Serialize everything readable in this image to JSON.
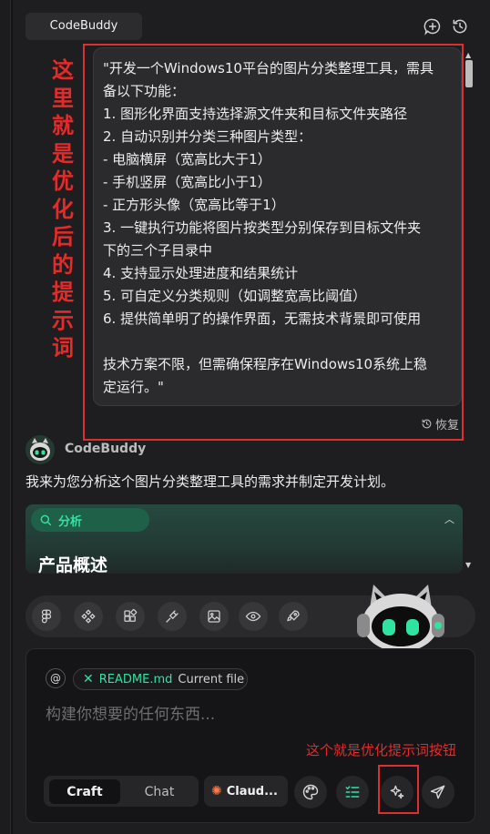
{
  "app": {
    "title": "CodeBuddy"
  },
  "header": {
    "new_chat_icon": "add-chat-icon",
    "history_icon": "history-icon"
  },
  "annotation": {
    "vertical_text": [
      "这",
      "里",
      "就",
      "是",
      "优",
      "化",
      "后",
      "的",
      "提",
      "示",
      "词"
    ],
    "button_note": "这个就是优化提示词按钮",
    "color": "#e52a2a"
  },
  "prompt": {
    "lines": [
      "\"开发一个Windows10平台的图片分类整理工具，需具",
      "备以下功能：",
      "1. 图形化界面支持选择源文件夹和目标文件夹路径",
      "2. 自动识别并分类三种图片类型：",
      "- 电脑横屏（宽高比大于1）",
      "- 手机竖屏（宽高比小于1）",
      "- 正方形头像（宽高比等于1）",
      "3. 一键执行功能将图片按类型分别保存到目标文件夹",
      "下的三个子目录中",
      "4. 支持显示处理进度和结果统计",
      "5. 可自定义分类规则（如调整宽高比阈值）",
      "6. 提供简单明了的操作界面，无需技术背景即可使用",
      "",
      "技术方案不限，但需确保程序在Windows10系统上稳",
      "定运行。\""
    ],
    "restore_label": "恢复"
  },
  "assistant": {
    "name": "CodeBuddy",
    "message": "我来为您分析这个图片分类整理工具的需求并制定开发计划。",
    "analysis_label": "分析",
    "section_heading": "产品概述"
  },
  "tools": [
    "figma-icon",
    "components-icon",
    "blocks-icon",
    "plug-icon",
    "image-icon",
    "eye-icon",
    "rocket-icon"
  ],
  "input": {
    "at_symbol": "@",
    "file_chip": {
      "name": "README.md",
      "tag": "Current file"
    },
    "placeholder": "构建你想要的任何东西..."
  },
  "bottom": {
    "modes": {
      "craft": "Craft",
      "chat": "Chat"
    },
    "model": "Claud...",
    "accent": "#2fe3a1"
  }
}
